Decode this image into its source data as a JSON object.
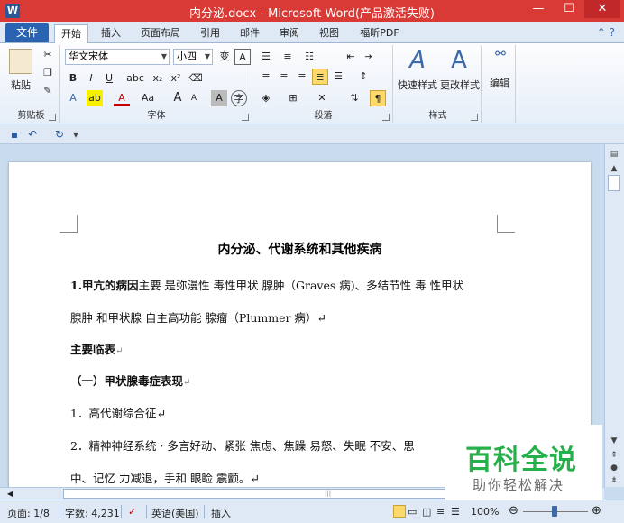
{
  "window": {
    "title": "内分泌.docx - Microsoft Word(产品激活失败)",
    "app_icon_letter": "W",
    "minimize": "—",
    "maximize": "☐",
    "close": "✕"
  },
  "tabs": {
    "file": "文件",
    "items": [
      "开始",
      "插入",
      "页面布局",
      "引用",
      "邮件",
      "审阅",
      "视图",
      "福昕PDF"
    ],
    "active_index": 0
  },
  "ribbon": {
    "clipboard": {
      "label": "剪贴板",
      "paste": "粘贴"
    },
    "font": {
      "label": "字体",
      "font_name": "华文宋体",
      "font_size": "小四",
      "bold": "B",
      "italic": "I",
      "underline": "U",
      "strike": "abc",
      "subscript": "x₂",
      "superscript": "x²",
      "grow": "A",
      "shrink": "A",
      "change_case": "Aa",
      "clear": "A",
      "font_color": "A",
      "char_shade": "A",
      "enclosed": "字"
    },
    "paragraph": {
      "label": "段落"
    },
    "styles": {
      "label": "样式",
      "quick_styles": "快速样式",
      "change_styles": "更改样式"
    },
    "editing": {
      "label": "编辑",
      "edit": "编辑"
    }
  },
  "document": {
    "title": "内分泌、代谢系统和其他疾病",
    "lines": [
      {
        "bold_prefix": "1.甲亢的病因",
        "text": "主要 是弥漫性 毒性甲状 腺肿（Graves 病)、多结节性 毒 性甲状"
      },
      {
        "bold_prefix": "",
        "text": "腺肿 和甲状腺 自主高功能 腺瘤（Plummer 病）↵"
      },
      {
        "bold_prefix": "主要临表",
        "text": "↵"
      },
      {
        "bold_prefix": "（一）甲状腺毒症表现",
        "text": "↵"
      },
      {
        "bold_prefix": "",
        "text": "1．高代谢综合征↵"
      },
      {
        "bold_prefix": "",
        "text": "2．精神神经系统 · 多言好动、紧张 焦虑、焦躁 易怒、失眠 不安、思"
      },
      {
        "bold_prefix": "",
        "text": "中、记忆 力减退，手和 眼睑 震颤。↵"
      }
    ]
  },
  "status": {
    "page": "页面: 1/8",
    "words": "字数: 4,231",
    "language": "英语(美国)",
    "mode": "插入",
    "zoom": "100%",
    "zoom_level_fraction": 0.5
  },
  "watermark": {
    "main": "百科全说",
    "sub": "助你轻松解决"
  }
}
